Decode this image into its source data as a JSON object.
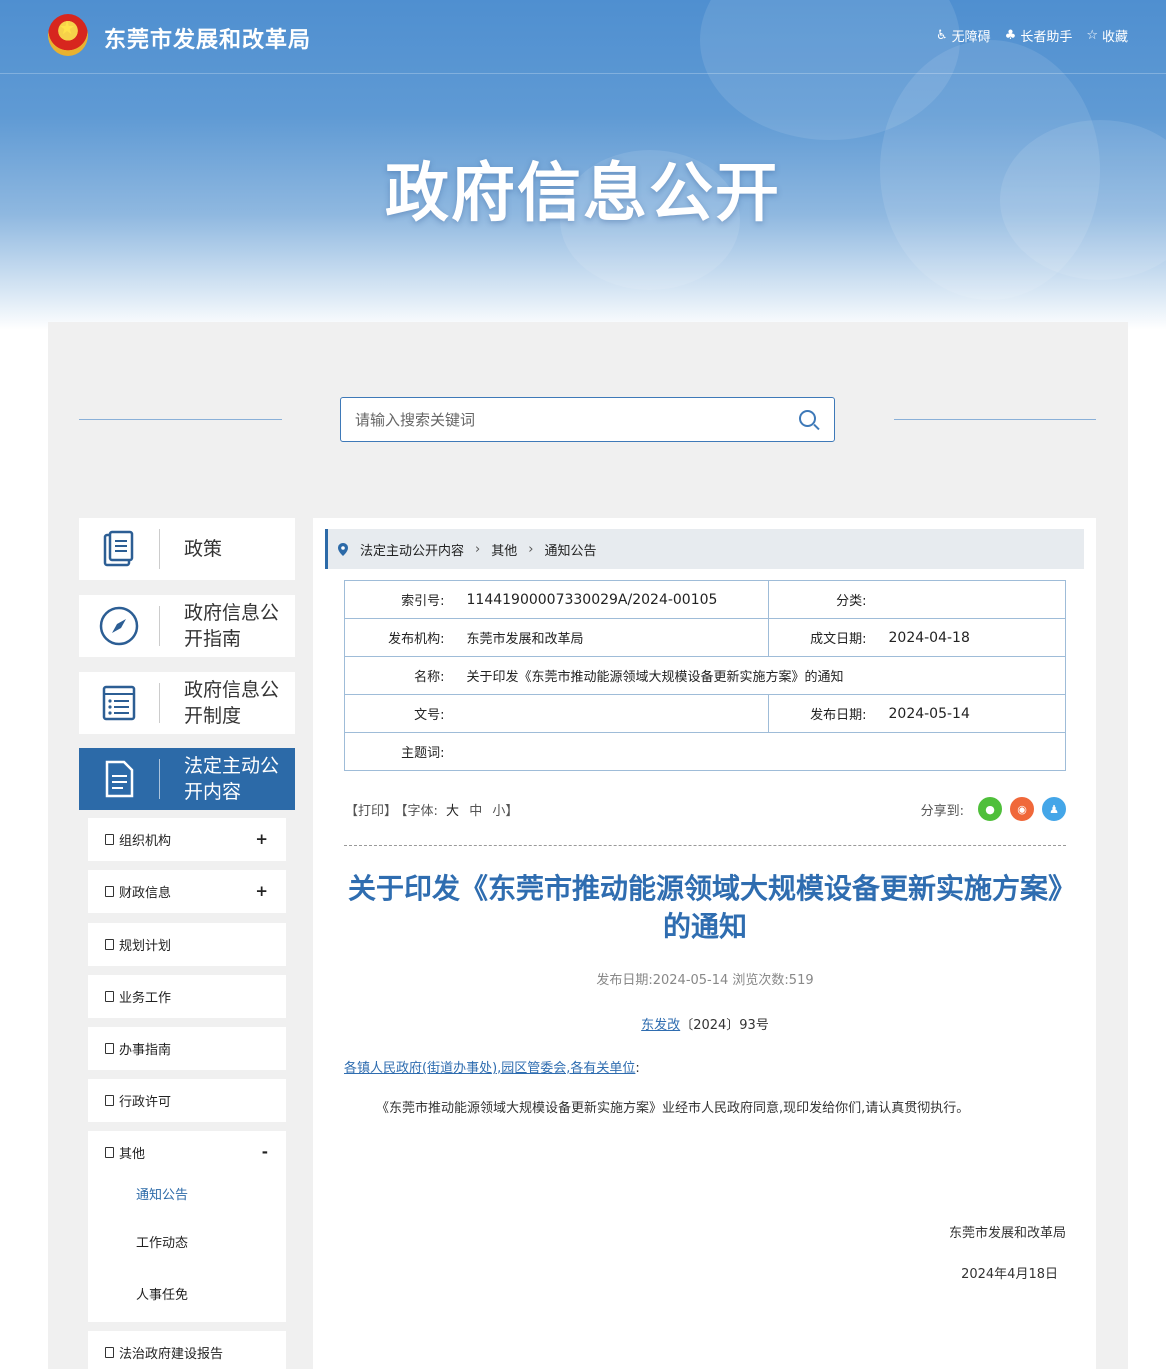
{
  "header": {
    "site_title": "东莞市发展和改革局",
    "links": [
      {
        "label": "无障碍",
        "icon": "accessibility-icon"
      },
      {
        "label": "长者助手",
        "icon": "elder-assist-icon"
      },
      {
        "label": "收藏",
        "icon": "star-icon"
      }
    ],
    "hero_title": "政府信息公开"
  },
  "search": {
    "placeholder": "请输入搜索关键词"
  },
  "sidebar": {
    "categories": [
      {
        "label": "政策",
        "icon": "policy-book-icon"
      },
      {
        "label": "政府信息公开指南",
        "icon": "compass-icon"
      },
      {
        "label": "政府信息公开制度",
        "icon": "list-document-icon"
      },
      {
        "label": "法定主动公开内容",
        "icon": "document-icon"
      }
    ],
    "subitems": [
      {
        "label": "组织机构",
        "toggle": "+"
      },
      {
        "label": "财政信息",
        "toggle": "+"
      },
      {
        "label": "规划计划"
      },
      {
        "label": "业务工作"
      },
      {
        "label": "办事指南"
      },
      {
        "label": "行政许可"
      },
      {
        "label": "其他",
        "toggle": "-"
      },
      {
        "label": "法治政府建设报告"
      }
    ],
    "other_children": [
      "通知公告",
      "工作动态",
      "人事任免"
    ]
  },
  "breadcrumb": [
    "法定主动公开内容",
    "其他",
    "通知公告"
  ],
  "meta": {
    "index_label": "索引号:",
    "index_value": "11441900007330029A/2024-00105",
    "category_label": "分类:",
    "category_value": "",
    "publisher_label": "发布机构:",
    "publisher_value": "东莞市发展和改革局",
    "created_label": "成文日期:",
    "created_value": "2024-04-18",
    "name_label": "名称:",
    "name_value": "关于印发《东莞市推动能源领域大规模设备更新实施方案》的通知",
    "docno_label": "文号:",
    "docno_value": "",
    "pubdate_label": "发布日期:",
    "pubdate_value": "2024-05-14",
    "keywords_label": "主题词:",
    "keywords_value": ""
  },
  "tools": {
    "print": "【打印】",
    "font_prefix": "【字体:",
    "font_large": "大",
    "font_medium": "中",
    "font_small": "小",
    "font_suffix": "】",
    "share_label": "分享到:"
  },
  "article": {
    "title": "关于印发《东莞市推动能源领域大规模设备更新实施方案》的通知",
    "publish_info": "发布日期:2024-05-14 浏览次数:519",
    "doc_number_link": "东发改",
    "doc_number_rest": "〔2024〕93号",
    "recipients_link": "各镇人民政府(街道办事处),园区管委会,各有关单位",
    "recipients_suffix": ":",
    "body": "《东莞市推动能源领域大规模设备更新实施方案》业经市人民政府同意,现印发给你们,请认真贯彻执行。",
    "signature": "东莞市发展和改革局",
    "sign_date": "2024年4月18日"
  },
  "colors": {
    "accent": "#2c6aa8",
    "title": "#2f6db0",
    "panel": "#f0f0f0"
  }
}
